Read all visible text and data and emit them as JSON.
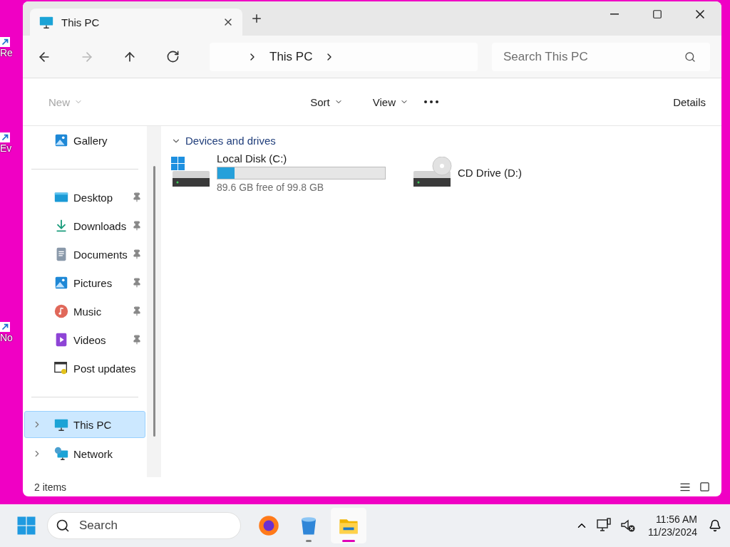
{
  "desktop": {
    "shortcuts": [
      {
        "label": "Re"
      },
      {
        "label": "Ev"
      },
      {
        "label": "No"
      }
    ]
  },
  "window": {
    "tabs": [
      {
        "title": "This PC",
        "selected": true
      }
    ],
    "nav": [
      {
        "kind": "back",
        "disabled": false
      },
      {
        "kind": "forward",
        "disabled": true
      },
      {
        "kind": "up",
        "disabled": false
      },
      {
        "kind": "refresh",
        "disabled": false
      }
    ],
    "address": {
      "path": [
        "This PC"
      ]
    },
    "search": {
      "placeholder": "Search This PC"
    },
    "commands": [
      {
        "label": "New",
        "disabled": true
      },
      {
        "label": "Sort",
        "disabled": false
      },
      {
        "label": "View",
        "disabled": false
      }
    ],
    "details": "Details",
    "sidebar": {
      "groups": [
        [
          {
            "label": "Gallery",
            "kind": "gallery",
            "pinned": false,
            "selected": false,
            "expandable": false
          }
        ],
        [
          {
            "label": "Desktop",
            "kind": "desktop",
            "pinned": true,
            "selected": false,
            "expandable": false
          },
          {
            "label": "Downloads",
            "kind": "downloads",
            "pinned": true,
            "selected": false,
            "expandable": false
          },
          {
            "label": "Documents",
            "kind": "documents",
            "pinned": true,
            "selected": false,
            "expandable": false
          },
          {
            "label": "Pictures",
            "kind": "pictures",
            "pinned": true,
            "selected": false,
            "expandable": false
          },
          {
            "label": "Music",
            "kind": "music",
            "pinned": true,
            "selected": false,
            "expandable": false
          },
          {
            "label": "Videos",
            "kind": "videos",
            "pinned": true,
            "selected": false,
            "expandable": false
          },
          {
            "label": "Post updates",
            "kind": "post",
            "pinned": false,
            "selected": false,
            "expandable": false
          }
        ],
        [
          {
            "label": "This PC",
            "kind": "pc",
            "pinned": false,
            "selected": true,
            "expandable": true
          },
          {
            "label": "Network",
            "kind": "network",
            "pinned": false,
            "selected": false,
            "expandable": true
          }
        ]
      ]
    },
    "section": {
      "title": "Devices and drives",
      "expanded": true
    },
    "drives": [
      {
        "name": "Local Disk (C:)",
        "kind": "disk",
        "level": 0.1,
        "free": "89.6 GB free of 99.8 GB"
      },
      {
        "name": "CD Drive (D:)",
        "kind": "cd"
      }
    ],
    "status_bar": {
      "count": "2 items"
    }
  },
  "taskbar": {
    "search": {
      "placeholder": "Search"
    },
    "apps": [
      {
        "kind": "firefox",
        "running": false,
        "active": false
      },
      {
        "kind": "bin",
        "running": true,
        "active": false
      },
      {
        "kind": "explorer",
        "running": true,
        "active": true
      }
    ],
    "time": "11:56 AM",
    "date": "11/23/2024"
  }
}
